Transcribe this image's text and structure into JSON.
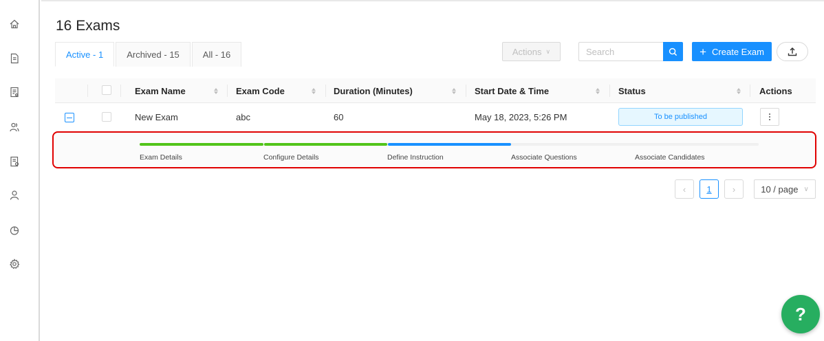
{
  "sidebar": {
    "items": [
      {
        "icon": "home-icon"
      },
      {
        "icon": "document-icon"
      },
      {
        "icon": "exam-list-icon"
      },
      {
        "icon": "users-group-icon"
      },
      {
        "icon": "question-bank-icon"
      },
      {
        "icon": "user-icon"
      },
      {
        "icon": "reports-pie-icon"
      },
      {
        "icon": "settings-gear-icon"
      }
    ]
  },
  "header": {
    "title": "16 Exams"
  },
  "tabs": [
    {
      "label": "Active - 1",
      "active": true
    },
    {
      "label": "Archived - 15",
      "active": false
    },
    {
      "label": "All - 16",
      "active": false
    }
  ],
  "toolbar": {
    "actions_label": "Actions",
    "search_placeholder": "Search",
    "create_label": "Create Exam",
    "accent": "#1890ff"
  },
  "table": {
    "columns": [
      "Exam Name",
      "Exam Code",
      "Duration (Minutes)",
      "Start Date & Time",
      "Status",
      "Actions"
    ],
    "rows": [
      {
        "exam_name": "New Exam",
        "exam_code": "abc",
        "duration": "60",
        "start": "May 18, 2023, 5:26 PM",
        "status": "To be published"
      }
    ]
  },
  "progress": {
    "steps": [
      {
        "label": "Exam Details",
        "state": "complete",
        "color": "#52c41a"
      },
      {
        "label": "Configure Details",
        "state": "complete",
        "color": "#52c41a"
      },
      {
        "label": "Define Instruction",
        "state": "current",
        "color": "#1890ff"
      },
      {
        "label": "Associate Questions",
        "state": "pending",
        "color": "#f0f0f0"
      },
      {
        "label": "Associate Candidates",
        "state": "pending",
        "color": "#f0f0f0"
      }
    ]
  },
  "pagination": {
    "current_page": "1",
    "page_size": "10 / page"
  },
  "help": {
    "label": "?",
    "color": "#27ae60"
  }
}
